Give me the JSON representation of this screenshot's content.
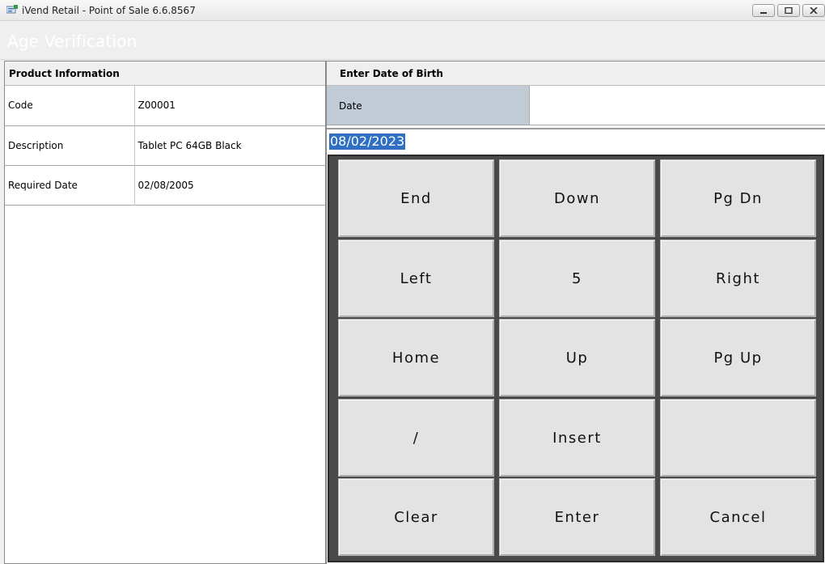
{
  "window": {
    "title": "iVend Retail - Point of Sale 6.6.8567",
    "app_icon": "ivend-app-icon"
  },
  "header": {
    "title": "Age Verification"
  },
  "product_panel": {
    "heading": "Product Information",
    "rows": [
      {
        "label": "Code",
        "value": "Z00001"
      },
      {
        "label": "Description",
        "value": "Tablet PC 64GB Black"
      },
      {
        "label": "Required Date",
        "value": "02/08/2005"
      }
    ]
  },
  "dob_panel": {
    "heading": "Enter Date of Birth",
    "date_label": "Date",
    "date_value": "08/02/2023"
  },
  "keypad": {
    "keys": [
      [
        "End",
        "Down",
        "Pg Dn"
      ],
      [
        "Left",
        "5",
        "Right"
      ],
      [
        "Home",
        "Up",
        "Pg Up"
      ],
      [
        "/",
        "Insert",
        ""
      ],
      [
        "Clear",
        "Enter",
        "Cancel"
      ]
    ]
  },
  "colors": {
    "date_label_bg": "#c0cbd6",
    "selection_bg": "#2f6fc4",
    "keypad_bg": "#4a4a4a",
    "key_bg": "#e3e3e3"
  }
}
